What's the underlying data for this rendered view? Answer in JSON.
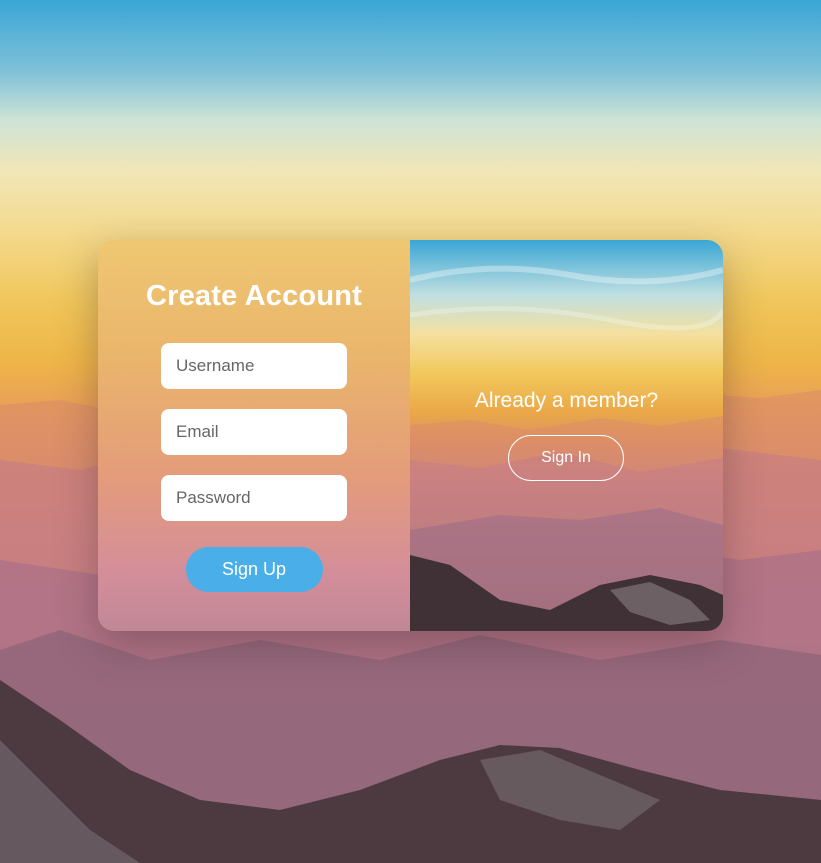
{
  "signup": {
    "title": "Create Account",
    "username_placeholder": "Username",
    "email_placeholder": "Email",
    "password_placeholder": "Password",
    "button_label": "Sign Up"
  },
  "signin": {
    "prompt": "Already a member?",
    "button_label": "Sign In"
  },
  "colors": {
    "signup_button": "#4aaee8",
    "text": "#ffffff"
  }
}
